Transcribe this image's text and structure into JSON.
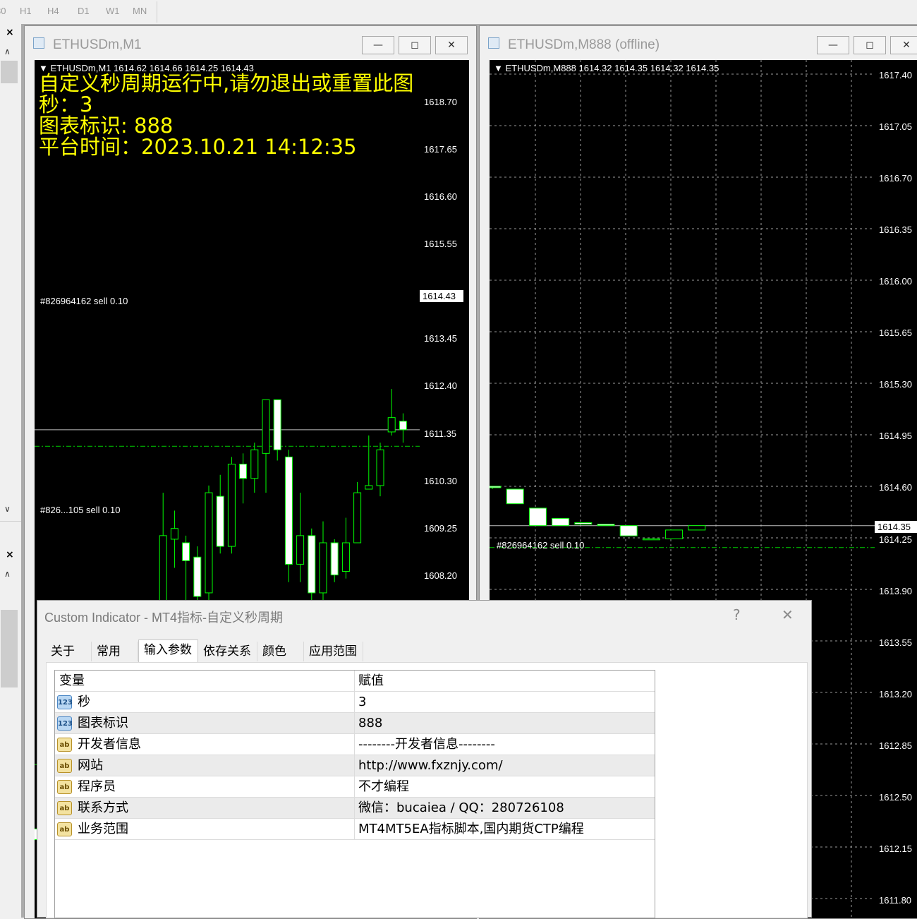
{
  "toolbar": {
    "timeframes": [
      "30",
      "H1",
      "H4",
      "D1",
      "W1",
      "MN"
    ]
  },
  "left_panel": {
    "close_glyph": "×"
  },
  "window_m1": {
    "title": "ETHUSDm,M1",
    "header_line": "ETHUSDm,M1  1614.62 1614.66 1614.25 1614.43",
    "overlay_lines": [
      "自定义秒周期运行中,请勿退出或重置此图",
      "秒：3",
      "图表标识: 888",
      "平台时间：2023.10.21 14:12:35"
    ],
    "price_labels": [
      "1618.70",
      "1617.65",
      "1616.60",
      "1615.55",
      "1613.45",
      "1612.40",
      "1611.35",
      "1610.30",
      "1609.25",
      "1608.20"
    ],
    "current_price": "1614.43",
    "order_labels": [
      "#826964162 sell 0.10",
      "#826...105 sell 0.10"
    ],
    "colors": {
      "background": "#000000",
      "bull": "#00ff00",
      "bear_fill": "#ffffff",
      "overlay_text": "#ffff00",
      "order_line": "#00cc00"
    }
  },
  "window_offline": {
    "title": "ETHUSDm,M888 (offline)",
    "header_line": "ETHUSDm,M888  1614.32 1614.35 1614.32 1614.35",
    "price_labels": [
      "1617.40",
      "1617.05",
      "1616.70",
      "1616.35",
      "1616.00",
      "1615.65",
      "1615.30",
      "1614.95",
      "1614.60",
      "1614.25",
      "1613.90",
      "1613.55",
      "1613.20",
      "1612.85",
      "1612.50",
      "1612.15",
      "1611.80"
    ],
    "current_price": "1614.35",
    "order_label": "#826964162 sell 0.10"
  },
  "window_buttons": {
    "minimize": "—",
    "restore": "◻",
    "close": "✕"
  },
  "dialog": {
    "title": "Custom Indicator - MT4指标-自定义秒周期",
    "help": "?",
    "close": "✕",
    "tabs": [
      "关于",
      "常用",
      "输入参数",
      "依存关系",
      "颜色",
      "应用范围"
    ],
    "active_tab": "输入参数",
    "grid": {
      "headers": [
        "变量",
        "赋值"
      ],
      "rows": [
        {
          "type_icon": "123",
          "name": "秒",
          "value": "3"
        },
        {
          "type_icon": "123",
          "name": "图表标识",
          "value": "888"
        },
        {
          "type_icon": "ab",
          "name": "开发者信息",
          "value": "--------开发者信息--------"
        },
        {
          "type_icon": "ab",
          "name": "网站",
          "value": "http://www.fxznjy.com/"
        },
        {
          "type_icon": "ab",
          "name": "程序员",
          "value": "不才编程"
        },
        {
          "type_icon": "ab",
          "name": "联系方式",
          "value": "微信：bucaiea / QQ：280726108"
        },
        {
          "type_icon": "ab",
          "name": "业务范围",
          "value": "MT4MT5EA指标脚本,国内期货CTP编程"
        }
      ]
    }
  },
  "chart_data": [
    {
      "type": "candlestick",
      "symbol": "ETHUSDm,M1",
      "ylim": [
        1607.6,
        1619.6
      ],
      "candles": [
        {
          "o": 1608.85,
          "h": 1609.25,
          "l": 1608.3,
          "c": 1608.7
        },
        {
          "o": 1608.9,
          "h": 1609.35,
          "l": 1608.7,
          "c": 1609.45
        },
        {
          "o": 1609.4,
          "h": 1609.55,
          "l": 1608.85,
          "c": 1609.7
        },
        {
          "o": 1609.6,
          "h": 1609.75,
          "l": 1609.55,
          "c": 1609.85
        },
        {
          "o": 1609.85,
          "h": 1609.9,
          "l": 1609.5,
          "c": 1609.55
        },
        {
          "o": 1609.6,
          "h": 1609.65,
          "l": 1607.8,
          "c": 1608.4
        },
        {
          "o": 1608.45,
          "h": 1608.55,
          "l": 1608.3,
          "c": 1608.4
        },
        {
          "o": 1608.3,
          "h": 1609.75,
          "l": 1608.2,
          "c": 1609.55
        },
        {
          "o": 1609.6,
          "h": 1609.7,
          "l": 1609.45,
          "c": 1609.65
        },
        {
          "o": 1609.65,
          "h": 1610.5,
          "l": 1609.55,
          "c": 1610.4
        },
        {
          "o": 1610.4,
          "h": 1611.55,
          "l": 1610.3,
          "c": 1611.4
        },
        {
          "o": 1611.4,
          "h": 1613.55,
          "l": 1611.2,
          "c": 1612.95
        },
        {
          "o": 1612.9,
          "h": 1613.3,
          "l": 1612.5,
          "c": 1613.05
        },
        {
          "o": 1612.85,
          "h": 1612.95,
          "l": 1611.3,
          "c": 1612.6
        },
        {
          "o": 1612.65,
          "h": 1612.8,
          "l": 1611.9,
          "c": 1612.1
        },
        {
          "o": 1612.15,
          "h": 1613.65,
          "l": 1611.95,
          "c": 1613.55
        },
        {
          "o": 1613.5,
          "h": 1613.8,
          "l": 1612.7,
          "c": 1612.8
        },
        {
          "o": 1612.8,
          "h": 1614.05,
          "l": 1612.7,
          "c": 1613.95
        },
        {
          "o": 1613.95,
          "h": 1614.1,
          "l": 1613.4,
          "c": 1613.75
        },
        {
          "o": 1613.75,
          "h": 1614.25,
          "l": 1613.55,
          "c": 1614.15
        },
        {
          "o": 1614.1,
          "h": 1614.8,
          "l": 1613.55,
          "c": 1614.85
        },
        {
          "o": 1614.85,
          "h": 1614.85,
          "l": 1614.0,
          "c": 1614.15
        },
        {
          "o": 1614.05,
          "h": 1614.15,
          "l": 1612.3,
          "c": 1612.55
        },
        {
          "o": 1612.55,
          "h": 1613.55,
          "l": 1612.3,
          "c": 1612.95
        },
        {
          "o": 1612.95,
          "h": 1613.05,
          "l": 1611.9,
          "c": 1612.15
        },
        {
          "o": 1612.15,
          "h": 1613.15,
          "l": 1611.95,
          "c": 1612.85
        },
        {
          "o": 1612.85,
          "h": 1612.9,
          "l": 1612.3,
          "c": 1612.4
        },
        {
          "o": 1612.45,
          "h": 1613.2,
          "l": 1612.35,
          "c": 1612.85
        },
        {
          "o": 1612.85,
          "h": 1613.7,
          "l": 1612.85,
          "c": 1613.55
        },
        {
          "o": 1613.6,
          "h": 1614.35,
          "l": 1613.6,
          "c": 1613.65
        },
        {
          "o": 1613.65,
          "h": 1614.25,
          "l": 1613.5,
          "c": 1614.15
        },
        {
          "o": 1614.4,
          "h": 1615.0,
          "l": 1614.35,
          "c": 1614.6
        },
        {
          "o": 1614.55,
          "h": 1614.66,
          "l": 1614.25,
          "c": 1614.43
        }
      ],
      "hlines": [
        1614.43,
        1614.2,
        1609.75
      ]
    },
    {
      "type": "candlestick",
      "symbol": "ETHUSDm,M888 (offline)",
      "ylim": [
        1611.66,
        1617.54
      ],
      "candles": [
        {
          "o": 1614.62,
          "h": 1614.62,
          "l": 1614.6,
          "c": 1614.61
        },
        {
          "o": 1614.6,
          "h": 1614.6,
          "l": 1614.5,
          "c": 1614.5
        },
        {
          "o": 1614.47,
          "h": 1614.47,
          "l": 1614.35,
          "c": 1614.35
        },
        {
          "o": 1614.4,
          "h": 1614.4,
          "l": 1614.35,
          "c": 1614.35
        },
        {
          "o": 1614.37,
          "h": 1614.37,
          "l": 1614.36,
          "c": 1614.36
        },
        {
          "o": 1614.36,
          "h": 1614.36,
          "l": 1614.35,
          "c": 1614.35
        },
        {
          "o": 1614.35,
          "h": 1614.35,
          "l": 1614.28,
          "c": 1614.28
        },
        {
          "o": 1614.26,
          "h": 1614.26,
          "l": 1614.26,
          "c": 1614.26
        },
        {
          "o": 1614.26,
          "h": 1614.32,
          "l": 1614.26,
          "c": 1614.32
        },
        {
          "o": 1614.32,
          "h": 1614.35,
          "l": 1614.32,
          "c": 1614.35
        }
      ],
      "hlines": [
        1614.35,
        1614.2
      ]
    }
  ]
}
